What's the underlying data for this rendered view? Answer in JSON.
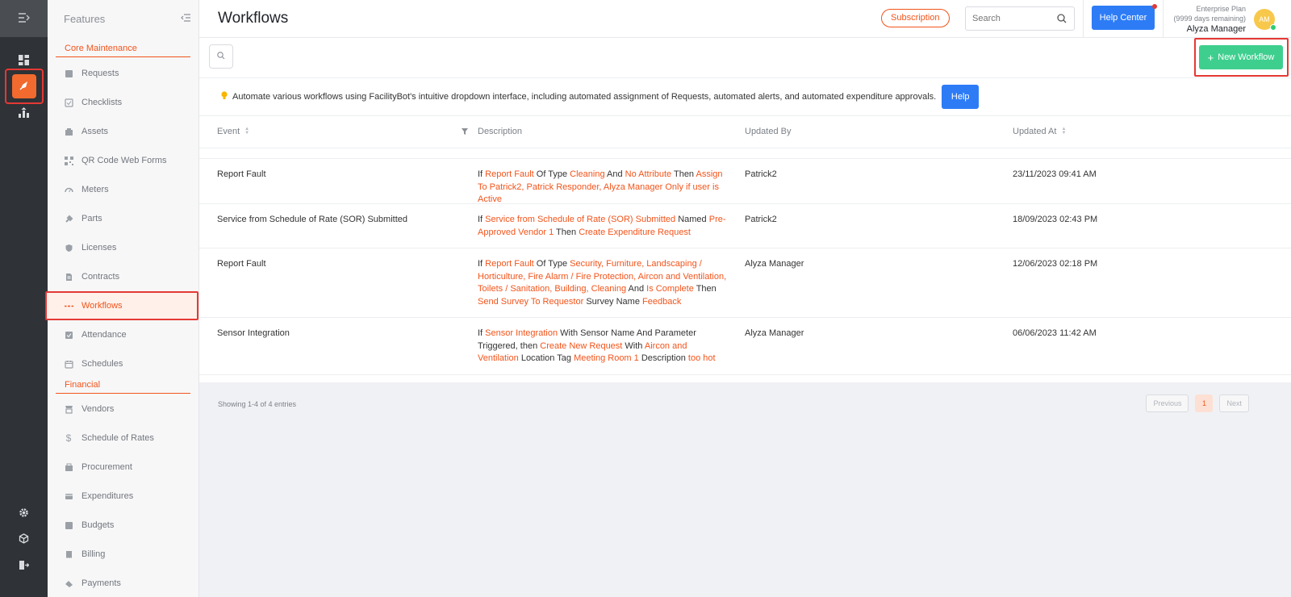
{
  "rail": {
    "icons": [
      "menu-icon",
      "dashboard-icon",
      "feature-rocket-icon",
      "analytics-icon",
      "settings-icon",
      "cube-icon",
      "logout-icon"
    ]
  },
  "sidebar": {
    "title": "Features",
    "sections": [
      {
        "label": "Core Maintenance",
        "items": [
          {
            "label": "Requests",
            "icon": "requests-icon"
          },
          {
            "label": "Checklists",
            "icon": "checklists-icon"
          },
          {
            "label": "Assets",
            "icon": "assets-icon"
          },
          {
            "label": "QR Code Web Forms",
            "icon": "qr-code-icon"
          },
          {
            "label": "Meters",
            "icon": "meters-icon"
          },
          {
            "label": "Parts",
            "icon": "parts-icon"
          },
          {
            "label": "Licenses",
            "icon": "licenses-icon"
          },
          {
            "label": "Contracts",
            "icon": "contracts-icon"
          },
          {
            "label": "Workflows",
            "icon": "workflows-icon",
            "active": true
          },
          {
            "label": "Attendance",
            "icon": "attendance-icon"
          },
          {
            "label": "Schedules",
            "icon": "schedules-icon"
          }
        ]
      },
      {
        "label": "Financial",
        "items": [
          {
            "label": "Vendors",
            "icon": "vendors-icon"
          },
          {
            "label": "Schedule of Rates",
            "icon": "dollar-icon"
          },
          {
            "label": "Procurement",
            "icon": "procurement-icon"
          },
          {
            "label": "Expenditures",
            "icon": "expenditures-icon"
          },
          {
            "label": "Budgets",
            "icon": "budgets-icon"
          },
          {
            "label": "Billing",
            "icon": "billing-icon"
          },
          {
            "label": "Payments",
            "icon": "payments-icon"
          }
        ]
      }
    ]
  },
  "header": {
    "title": "Workflows",
    "subscription_label": "Subscription",
    "search_placeholder": "Search",
    "help_center_label": "Help Center",
    "plan_name": "Enterprise Plan",
    "plan_remaining": "(9999 days remaining)",
    "user_name": "Alyza Manager",
    "avatar_initials": "AM"
  },
  "toolbar": {
    "new_workflow_label": "New Workflow"
  },
  "info": {
    "text": "Automate various workflows using FacilityBot's intuitive dropdown interface, including automated assignment of Requests, automated alerts, and automated expenditure approvals.",
    "help_label": "Help"
  },
  "table": {
    "columns": {
      "event": "Event",
      "description": "Description",
      "updated_by": "Updated By",
      "updated_at": "Updated At"
    },
    "rows": [
      {
        "event": "Report Fault",
        "description": [
          {
            "t": "If ",
            "h": false
          },
          {
            "t": "Report Fault",
            "h": true
          },
          {
            "t": " Of Type ",
            "h": false
          },
          {
            "t": "Cleaning",
            "h": true
          },
          {
            "t": " And ",
            "h": false
          },
          {
            "t": "No Attribute",
            "h": true
          },
          {
            "t": " Then ",
            "h": false
          },
          {
            "t": "Assign To Patrick2, Patrick Responder, Alyza Manager Only if user is Active",
            "h": true
          }
        ],
        "updated_by": "Patrick2",
        "updated_at": "23/11/2023 09:41 AM"
      },
      {
        "event": "Service from Schedule of Rate (SOR) Submitted",
        "description": [
          {
            "t": "If ",
            "h": false
          },
          {
            "t": "Service from Schedule of Rate (SOR) Submitted",
            "h": true
          },
          {
            "t": " Named ",
            "h": false
          },
          {
            "t": "Pre-Approved Vendor 1",
            "h": true
          },
          {
            "t": " Then ",
            "h": false
          },
          {
            "t": "Create Expenditure Request",
            "h": true
          }
        ],
        "updated_by": "Patrick2",
        "updated_at": "18/09/2023 02:43 PM"
      },
      {
        "event": "Report Fault",
        "description": [
          {
            "t": "If ",
            "h": false
          },
          {
            "t": "Report Fault",
            "h": true
          },
          {
            "t": " Of Type ",
            "h": false
          },
          {
            "t": "Security, Furniture, Landscaping / Horticulture, Fire Alarm / Fire Protection, Aircon and Ventilation, Toilets / Sanitation, Building, Cleaning",
            "h": true
          },
          {
            "t": " And ",
            "h": false
          },
          {
            "t": "Is Complete",
            "h": true
          },
          {
            "t": " Then ",
            "h": false
          },
          {
            "t": "Send Survey To Requestor",
            "h": true
          },
          {
            "t": " Survey Name ",
            "h": false
          },
          {
            "t": "Feedback",
            "h": true
          }
        ],
        "updated_by": "Alyza Manager",
        "updated_at": "12/06/2023 02:18 PM"
      },
      {
        "event": "Sensor Integration",
        "description": [
          {
            "t": "If ",
            "h": false
          },
          {
            "t": "Sensor Integration",
            "h": true
          },
          {
            "t": " With Sensor Name And Parameter Triggered, then ",
            "h": false
          },
          {
            "t": "Create New Request",
            "h": true
          },
          {
            "t": " With ",
            "h": false
          },
          {
            "t": "Aircon and Ventilation",
            "h": true
          },
          {
            "t": " Location Tag ",
            "h": false
          },
          {
            "t": "Meeting Room 1",
            "h": true
          },
          {
            "t": " Description ",
            "h": false
          },
          {
            "t": "too hot",
            "h": true
          }
        ],
        "updated_by": "Alyza Manager",
        "updated_at": "06/06/2023 11:42 AM"
      }
    ]
  },
  "pagination": {
    "showing": "Showing 1-4 of 4 entries",
    "previous": "Previous",
    "current": "1",
    "next": "Next"
  },
  "colors": {
    "accent": "#f2541b",
    "primary": "#2d7cf6",
    "success": "#3ecf8e"
  }
}
